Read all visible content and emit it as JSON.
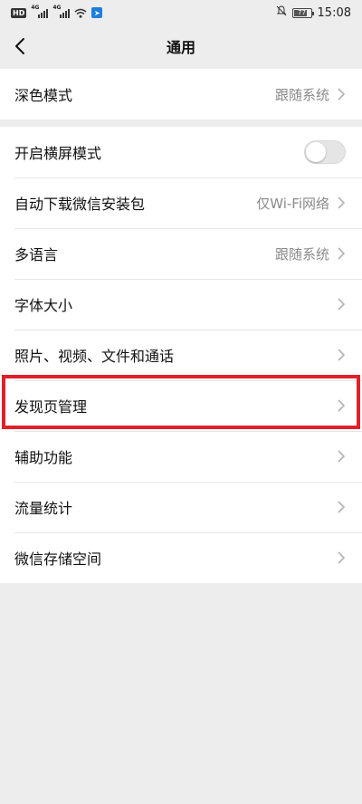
{
  "status_bar": {
    "left_badge": "HD",
    "signal_labels": [
      "4G",
      "4G"
    ],
    "battery": "77",
    "time": "15:08"
  },
  "header": {
    "title": "通用"
  },
  "groups": [
    {
      "items": [
        {
          "label": "深色模式",
          "value": "跟随系统",
          "control": "chevron"
        }
      ]
    },
    {
      "items": [
        {
          "label": "开启横屏模式",
          "value": "",
          "control": "toggle",
          "toggle_on": false
        },
        {
          "label": "自动下载微信安装包",
          "value": "仅Wi-Fi网络",
          "control": "chevron"
        },
        {
          "label": "多语言",
          "value": "跟随系统",
          "control": "chevron"
        },
        {
          "label": "字体大小",
          "value": "",
          "control": "chevron"
        },
        {
          "label": "照片、视频、文件和通话",
          "value": "",
          "control": "chevron"
        },
        {
          "label": "发现页管理",
          "value": "",
          "control": "chevron",
          "highlighted": true
        },
        {
          "label": "辅助功能",
          "value": "",
          "control": "chevron"
        },
        {
          "label": "流量统计",
          "value": "",
          "control": "chevron"
        },
        {
          "label": "微信存储空间",
          "value": "",
          "control": "chevron"
        }
      ]
    }
  ],
  "colors": {
    "background": "#ededed",
    "card": "#ffffff",
    "highlight_border": "#e0202a",
    "secondary_text": "#8a8a8a"
  }
}
